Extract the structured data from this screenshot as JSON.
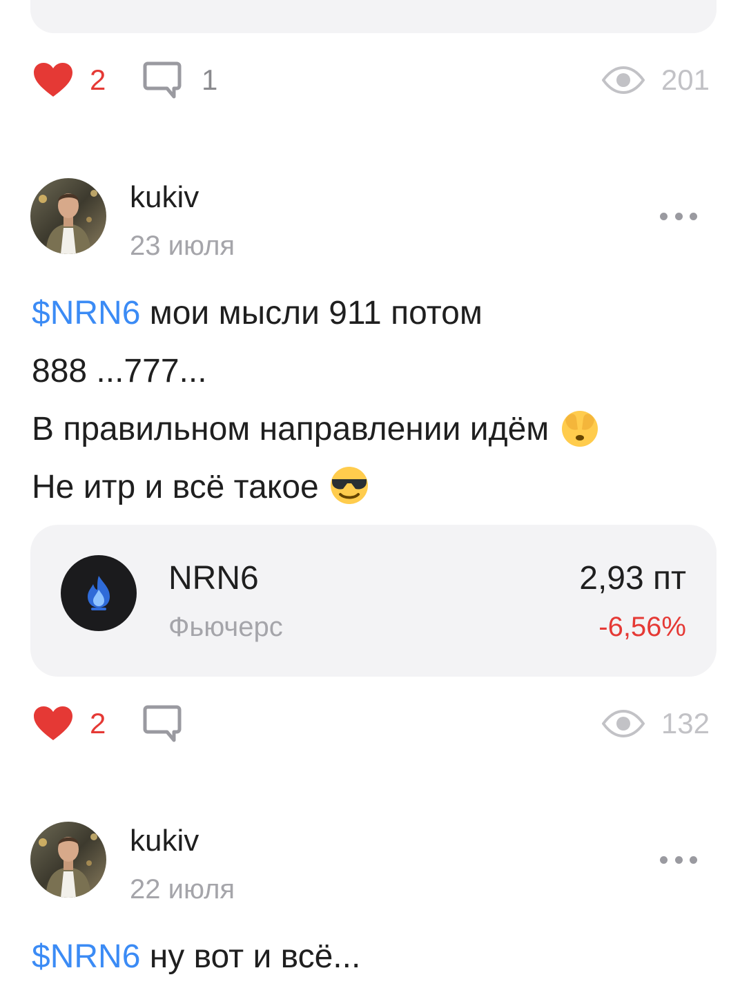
{
  "previous_post": {
    "likes": "2",
    "comments": "1",
    "views": "201"
  },
  "post1": {
    "author": "kukiv",
    "date": "23 июля",
    "ticker": "$NRN6",
    "text_line1": " мои мысли 911 потом",
    "text_line2": "888 ...777...",
    "text_line3": "В правильном направлении идём ",
    "text_line4": "Не итр и всё такое ",
    "emoji1": "see-no-evil-face-emoji",
    "emoji2": "smiling-face-with-sunglasses-emoji",
    "instrument": {
      "name": "NRN6",
      "type": "Фьючерс",
      "price": "2,93 пт",
      "change": "-6,56%",
      "icon": "gas-flame-icon"
    },
    "likes": "2",
    "views": "132"
  },
  "post2": {
    "author": "kukiv",
    "date": "22 июля",
    "ticker": "$NRN6",
    "text_line1": " ну вот и всё..."
  },
  "colors": {
    "like": "#e53935",
    "ticker": "#3b8bf5",
    "negative": "#e53935",
    "muted": "#a5a5aa",
    "card_bg": "#f3f3f5"
  }
}
